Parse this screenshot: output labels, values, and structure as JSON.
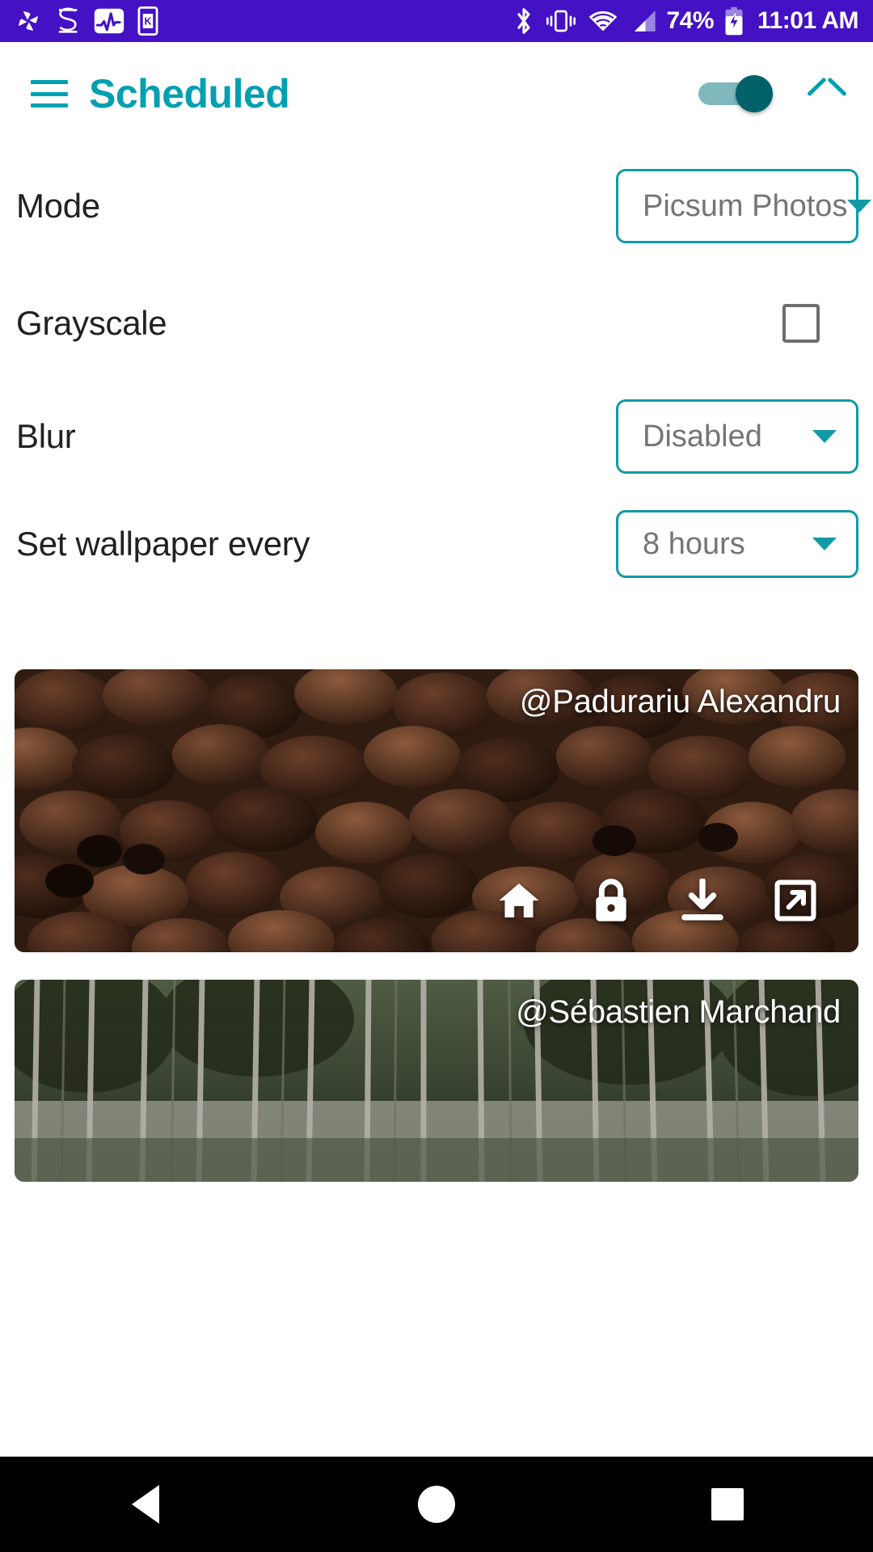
{
  "status_bar": {
    "background": "#4411c4",
    "notification_icons": [
      "pinwheel-icon",
      "s-logo-icon",
      "pulse-icon",
      "k-badge-icon"
    ],
    "system_icons": [
      "bluetooth-icon",
      "vibrate-icon",
      "wifi-icon",
      "cellular-signal-icon"
    ],
    "battery_percent": "74%",
    "battery_state": "charging",
    "clock": "11:01 AM"
  },
  "app_bar": {
    "menu_icon": "hamburger-menu-icon",
    "title": "Scheduled",
    "accent_color": "#00a0b0",
    "toggle": {
      "state": "on",
      "track_color": "#80b9bd",
      "knob_color": "#00616b"
    },
    "collapse_icon": "chevron-up-icon"
  },
  "settings": [
    {
      "label": "Mode",
      "control": "dropdown",
      "value": "Picsum Photos",
      "caret_icon": "chevron-down-icon"
    },
    {
      "label": "Grayscale",
      "control": "checkbox",
      "checked": false
    },
    {
      "label": "Blur",
      "control": "dropdown",
      "value": "Disabled",
      "caret_icon": "chevron-down-icon"
    },
    {
      "label": "Set wallpaper every",
      "control": "dropdown",
      "value": "8 hours",
      "caret_icon": "chevron-down-icon"
    }
  ],
  "photo_cards": [
    {
      "attribution": "@Padurariu Alexandru",
      "subject": "roasted coffee beans",
      "actions": [
        "home-icon",
        "lock-icon",
        "download-icon",
        "open-external-icon"
      ]
    },
    {
      "attribution": "@Sébastien Marchand",
      "subject": "tall pine forest",
      "actions": []
    }
  ],
  "nav_bar": {
    "background": "#000000",
    "buttons": [
      "back-icon",
      "home-icon",
      "recent-apps-icon"
    ]
  }
}
